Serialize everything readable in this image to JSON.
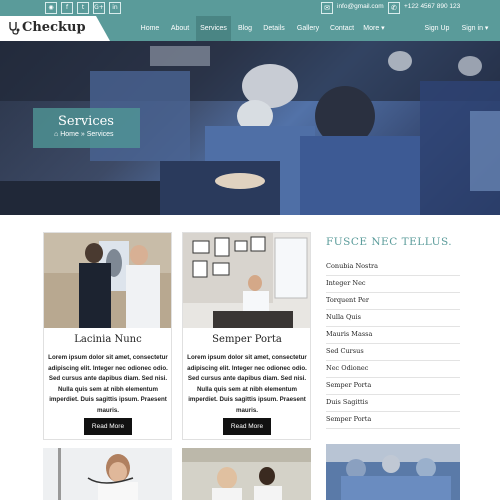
{
  "topbar": {
    "social_icons": [
      {
        "name": "rss-icon",
        "glyph": "◉"
      },
      {
        "name": "facebook-icon",
        "glyph": "f"
      },
      {
        "name": "twitter-icon",
        "glyph": "t"
      },
      {
        "name": "google-plus-icon",
        "glyph": "G+"
      },
      {
        "name": "linkedin-icon",
        "glyph": "in"
      }
    ],
    "email": "info@gmail.com",
    "phone": "+122 4567 890 123",
    "color": "#5a9b9a"
  },
  "logo": {
    "text": "Checkup",
    "icon": "stethoscope-icon"
  },
  "nav": {
    "items": [
      "Home",
      "About",
      "Services",
      "Blog",
      "Details",
      "Gallery",
      "Contact",
      "More ▾"
    ],
    "active": "Services",
    "sign_up": "Sign Up",
    "sign_in": "Sign in ▾"
  },
  "hero": {
    "title": "Services",
    "breadcrumb_home": "Home",
    "breadcrumb_sep": "»",
    "breadcrumb_current": "Services"
  },
  "cards": [
    {
      "title": "Lacinia Nunc",
      "text": "Lorem ipsum dolor sit amet, consectetur adipiscing elit. Integer nec odionec odio. Sed cursus ante dapibus diam. Sed nisi. Nulla quis sem at nibh elementum imperdiet. Duis sagittis ipsum. Praesent mauris.",
      "button": "Read More"
    },
    {
      "title": "Semper Porta",
      "text": "Lorem ipsum dolor sit amet, consectetur adipiscing elit. Integer nec odionec odio. Sed cursus ante dapibus diam. Sed nisi. Nulla quis sem at nibh elementum imperdiet. Duis sagittis ipsum. Praesent mauris.",
      "button": "Read More"
    }
  ],
  "sidebar": {
    "title": "FUSCE NEC TELLUS.",
    "items": [
      "Conubia Nostra",
      "Integer Nec",
      "Torquent Per",
      "Nulla Quis",
      "Mauris Massa",
      "Sed Cursus",
      "Nec Odionec",
      "Semper Porta",
      "Duis Sagittis",
      "Semper Porta"
    ]
  }
}
